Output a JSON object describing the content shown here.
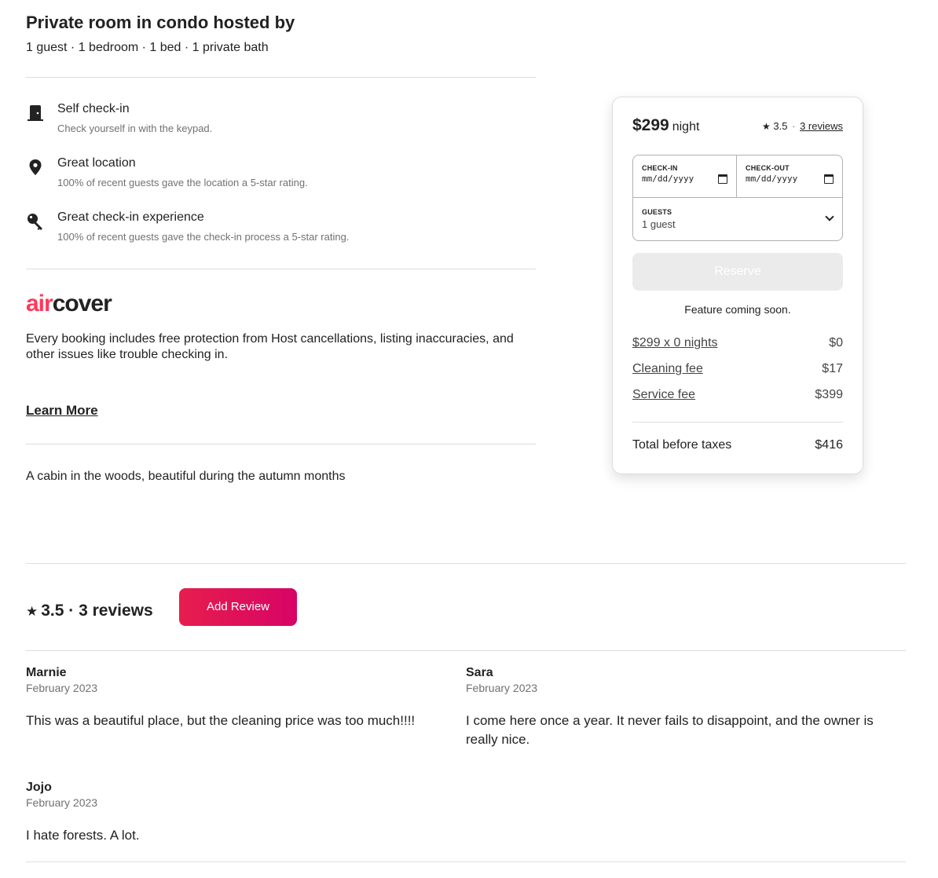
{
  "listing": {
    "title": "Private room in condo hosted by",
    "details": "1 guest · 1 bedroom · 1 bed · 1 private bath",
    "description": "A cabin in the woods, beautiful during the autumn months"
  },
  "features": [
    {
      "icon": "door-icon",
      "title": "Self check-in",
      "desc": "Check yourself in with the keypad."
    },
    {
      "icon": "location-pin-icon",
      "title": "Great location",
      "desc": "100% of recent guests gave the location a 5-star rating."
    },
    {
      "icon": "key-icon",
      "title": "Great check-in experience",
      "desc": "100% of recent guests gave the check-in process a 5-star rating."
    }
  ],
  "aircover": {
    "air": "air",
    "cover": "cover",
    "text": "Every booking includes free protection from Host cancellations, listing inaccuracies, and other issues like trouble checking in.",
    "learn_more": "Learn More",
    "brand_color": "#ff385c"
  },
  "booking": {
    "price": "$299",
    "unit": "night",
    "rating": "3.5",
    "dot": "·",
    "reviews_link": "3 reviews",
    "checkin_label": "CHECK-IN",
    "checkin_placeholder": "mm/dd/yyyy",
    "checkout_label": "CHECK-OUT",
    "checkout_placeholder": "mm/dd/yyyy",
    "guests_label": "GUESTS",
    "guests_value": "1 guest",
    "reserve_label": "Reserve",
    "coming_soon": "Feature coming soon.",
    "fees": [
      {
        "label": "$299 x 0 nights",
        "amount": "$0"
      },
      {
        "label": "Cleaning fee",
        "amount": "$17"
      },
      {
        "label": "Service fee",
        "amount": "$399"
      }
    ],
    "total_label": "Total before taxes",
    "total_amount": "$416"
  },
  "reviews": {
    "summary": "3.5 · 3 reviews",
    "add_review_label": "Add Review",
    "button_color": "#e61e4d",
    "items": [
      {
        "name": "Marnie",
        "date": "February 2023",
        "text": "This was a beautiful place, but the cleaning price was too much!!!!"
      },
      {
        "name": "Sara",
        "date": "February 2023",
        "text": "I come here once a year. It never fails to disappoint, and the owner is really nice."
      },
      {
        "name": "Jojo",
        "date": "February 2023",
        "text": "I hate forests. A lot."
      }
    ]
  }
}
